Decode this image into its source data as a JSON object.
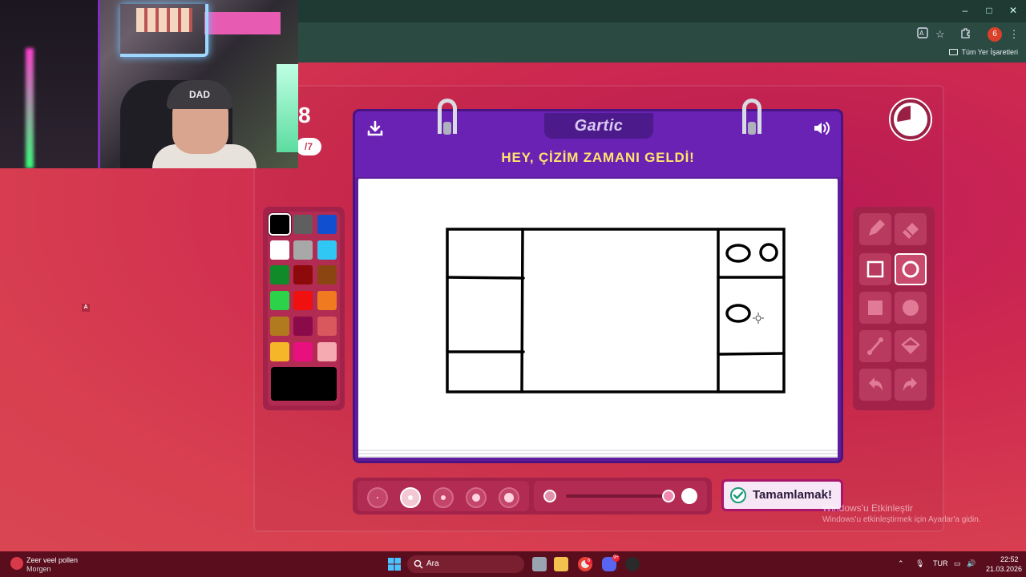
{
  "browser": {
    "window_controls": [
      "–",
      "□",
      "✕"
    ],
    "bookmarks_label": "Tüm Yer İşaretleri",
    "profile_badge": "6"
  },
  "webcam": {
    "cap_text": "DAD"
  },
  "behind_cam": {
    "number": "8",
    "pill": "/7"
  },
  "game": {
    "logo": "Gartic",
    "headline": "HEY, ÇİZİM ZAMANI GELDİ!",
    "done_button": "Tamamlamak!"
  },
  "palette": {
    "selected": "#000000",
    "colors": [
      "#000000",
      "#5f5f5f",
      "#1050d0",
      "#ffffff",
      "#a8a8a8",
      "#31c7f5",
      "#118a2a",
      "#8e0a0a",
      "#8a4510",
      "#2bd24a",
      "#f01010",
      "#f07a20",
      "#b27a1f",
      "#8a0a4a",
      "#d8585e",
      "#f6b62a",
      "#e8107e",
      "#f4aab0"
    ],
    "current": "#000000"
  },
  "tools": {
    "items": [
      "pencil-icon",
      "eraser-icon",
      "rectangle-outline-icon",
      "ellipse-outline-icon",
      "rectangle-filled-icon",
      "ellipse-filled-icon",
      "line-icon",
      "fill-bucket-icon",
      "undo-icon",
      "redo-icon"
    ],
    "active": "ellipse-outline-icon"
  },
  "brush": {
    "sizes": 5,
    "active_size_index": 1,
    "opacity": 1.0
  },
  "watermark": {
    "line1": "Windows'u Etkinleştir",
    "line2": "Windows'u etkinleştirmek için Ayarlar'a gidin."
  },
  "taskbar": {
    "weather_line1": "Zeer veel pollen",
    "weather_line2": "Morgen",
    "search_placeholder": "Ara",
    "lang": "TUR",
    "time": "22:52",
    "date": "21.03.2026",
    "chrome_badge": "6",
    "discord_badge": "9+"
  }
}
